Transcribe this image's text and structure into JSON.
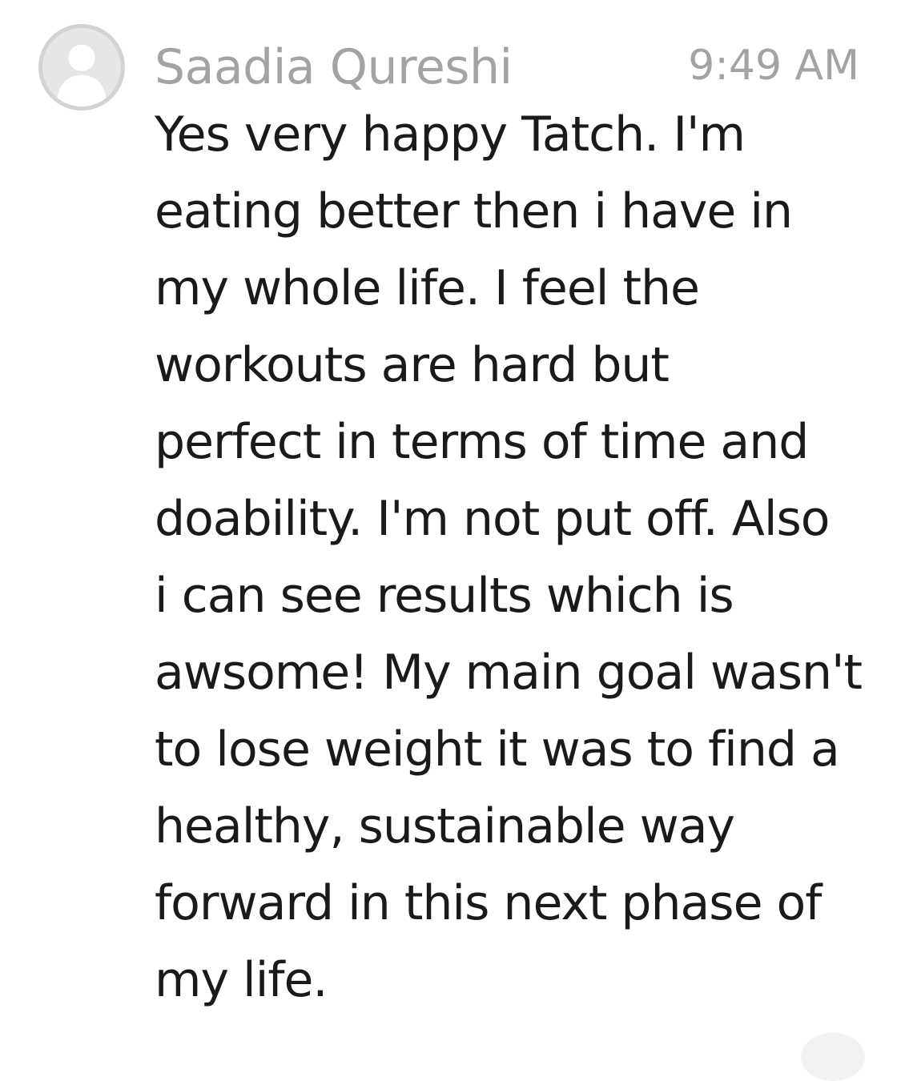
{
  "message": {
    "sender": "Saadia Qureshi",
    "time": "9:49 AM",
    "avatar_icon": "default-user-icon",
    "body_lines": [
      "Yes very happy Tatch. I'm",
      "eating better then i have in",
      "my whole life. I feel the",
      "workouts are hard but",
      "perfect in terms of time and",
      "doability. I'm not put off. Also",
      "i can see results which is",
      "awsome! My main goal wasn't",
      "to lose weight it was to find a",
      "healthy, sustainable way",
      "forward in this next phase of",
      "my life."
    ]
  },
  "colors": {
    "meta_text": "#a3a3a3",
    "body_text": "#1a1a1a",
    "avatar_ring": "#d3d3d3",
    "avatar_fill": "#e6e6e6",
    "avatar_figure": "#ffffff"
  }
}
